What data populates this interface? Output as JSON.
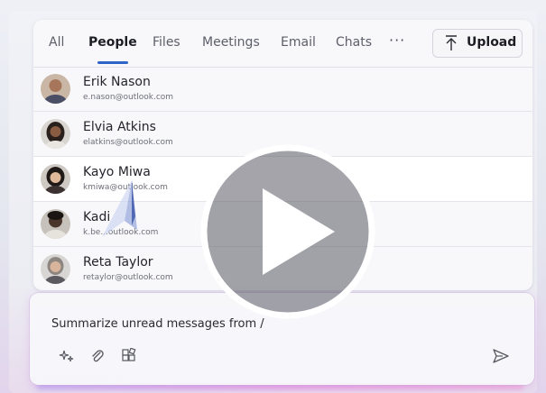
{
  "tabs": [
    {
      "label": "All"
    },
    {
      "label": "People",
      "active": true
    },
    {
      "label": "Files"
    },
    {
      "label": "Meetings"
    },
    {
      "label": "Email"
    },
    {
      "label": "Chats"
    }
  ],
  "more_label": "···",
  "upload_label": "Upload",
  "people": [
    {
      "name": "Erik Nason",
      "email": "e.nason@outlook.com",
      "avatar_bg": "#b98a6a"
    },
    {
      "name": "Elvia Atkins",
      "email": "elatkins@outlook.com",
      "avatar_bg": "#7d6b5e"
    },
    {
      "name": "Kayo Miwa",
      "email": "kmiwa@outlook.com",
      "avatar_bg": "#6b5a52"
    },
    {
      "name": "Kadi",
      "email": "k.be...outlook.com",
      "avatar_bg": "#5a4a40"
    },
    {
      "name": "Reta Taylor",
      "email": "retaylor@outlook.com",
      "avatar_bg": "#9a948e"
    }
  ],
  "compose": {
    "prompt": "Summarize unread messages from /"
  },
  "colors": {
    "accent": "#2f64c7",
    "play_overlay": "#ffffff"
  }
}
